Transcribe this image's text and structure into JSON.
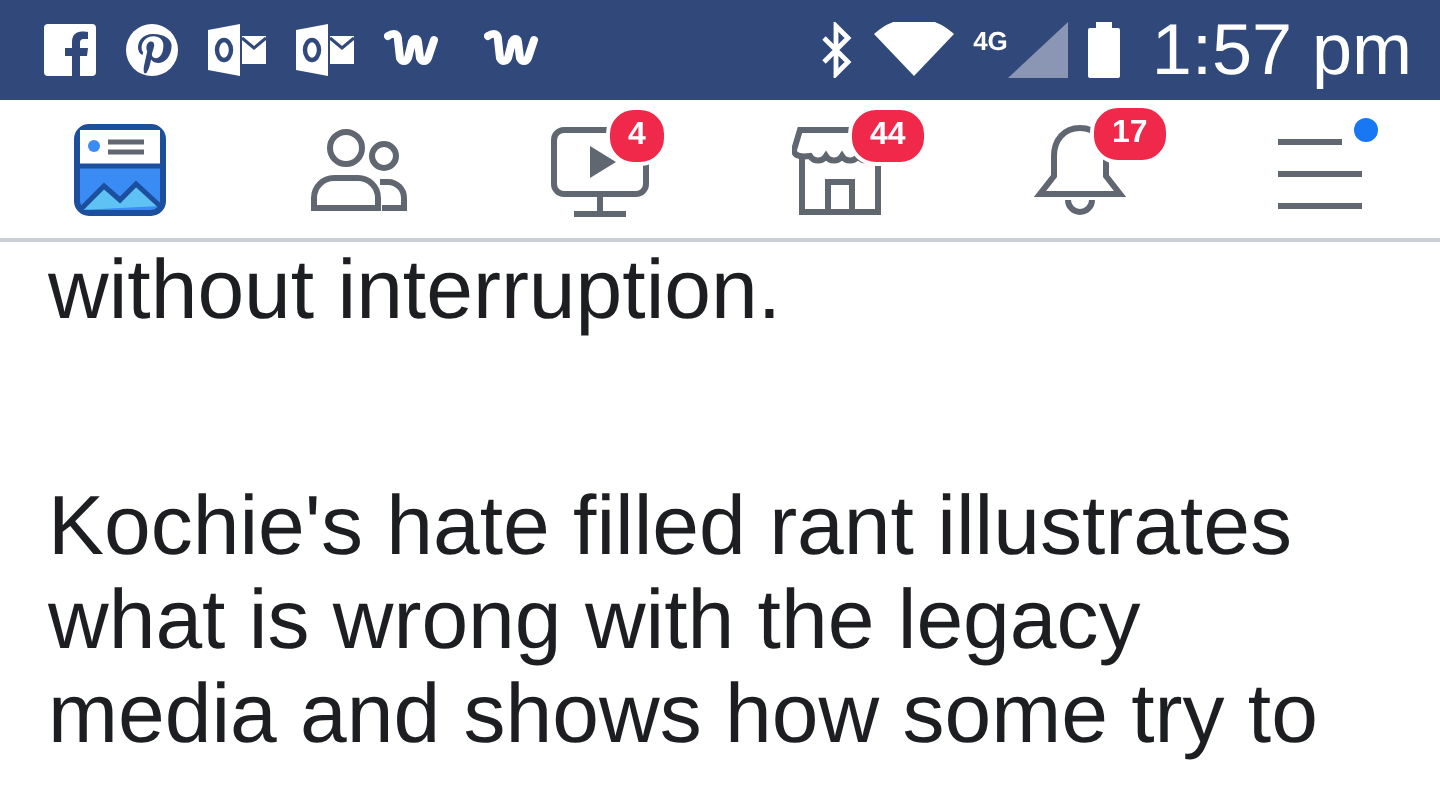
{
  "status_bar": {
    "network": "4G",
    "time": "1:57 pm"
  },
  "tabs": [
    {
      "kind": "feed",
      "selected": true
    },
    {
      "kind": "friends",
      "selected": false
    },
    {
      "kind": "watch",
      "selected": false,
      "badge": "4"
    },
    {
      "kind": "marketplace",
      "selected": false,
      "badge": "44"
    },
    {
      "kind": "notifications",
      "selected": false,
      "badge": "17"
    },
    {
      "kind": "menu",
      "selected": false,
      "dot": true
    }
  ],
  "post": {
    "paragraphs": [
      {
        "lines": [
          "without interruption."
        ]
      },
      {
        "lines": [
          "Kochie's hate filled rant illustrates",
          "what is wrong with the legacy",
          "media and shows how some try to"
        ]
      }
    ]
  }
}
